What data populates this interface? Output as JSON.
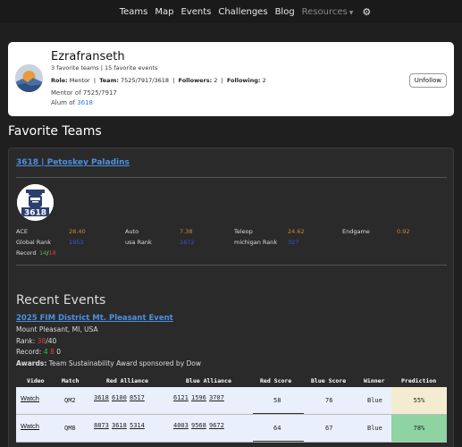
{
  "nav": {
    "items": [
      "Teams",
      "Map",
      "Events",
      "Challenges",
      "Blog"
    ],
    "resources_label": "Resources",
    "settings_icon": "gear-icon"
  },
  "profile": {
    "name": "Ezrafranseth",
    "subtitle": "3 favorite teams | 15 favorite events",
    "role_label": "Role:",
    "role": "Mentor",
    "team_label": "Team:",
    "team": "7525/7917/3618",
    "followers_label": "Followers:",
    "followers": "2",
    "following_label": "Following:",
    "following": "2",
    "mentor_text": "Mentor of 7525/7917",
    "alum_prefix": "Alum of ",
    "alum_team": "3618",
    "unfollow_label": "Unfollow"
  },
  "favorite_teams_title": "Favorite Teams",
  "team": {
    "link": "3618 | Petoskey Paladins",
    "logo_text": "3618",
    "stats": {
      "ace_label": "ACE",
      "ace": "28.40",
      "auto_label": "Auto",
      "auto": "7.38",
      "teleop_label": "Teleop",
      "teleop": "24.62",
      "endgame_label": "Endgame",
      "endgame": "0.92",
      "global_rank_label": "Global Rank",
      "global_rank": "1953",
      "usa_rank_label": "usa Rank",
      "usa_rank": "1672",
      "michigan_rank_label": "michigan Rank",
      "michigan_rank": "327",
      "record_label": "Record",
      "record_w": "14",
      "record_sep": "/",
      "record_l": "18"
    },
    "recent_events_title": "Recent Events",
    "event": {
      "name": "2025 FIM District Mt. Pleasant Event",
      "location": "Mount Pleasant, MI, USA",
      "rank_label": "Rank:",
      "rank": "38",
      "rank_total": "/40",
      "record_label": "Record:",
      "record_w": "4",
      "record_l": "8",
      "record_t": "0",
      "awards_label": "Awards:",
      "awards": "Team Sustainability Award sponsored by Dow"
    },
    "table": {
      "headers": [
        "Video",
        "Match",
        "Red Alliance",
        "Blue Alliance",
        "Red Score",
        "Blue Score",
        "Winner",
        "Prediction"
      ],
      "rows": [
        {
          "video": "Watch",
          "match": "QM2",
          "red": [
            "3618",
            "6100",
            "8517"
          ],
          "blue": [
            "6121",
            "1596",
            "3707"
          ],
          "red_score": "58",
          "blue_score": "76",
          "winner": "Blue",
          "prediction": "55%",
          "pred_color": "#f3ecd0"
        },
        {
          "video": "Watch",
          "match": "QM8",
          "red": [
            "8873",
            "3618",
            "5314"
          ],
          "blue": [
            "4003",
            "9568",
            "9672"
          ],
          "red_score": "64",
          "blue_score": "67",
          "winner": "Blue",
          "prediction": "78%",
          "pred_color": "#8fd3a2"
        }
      ]
    }
  },
  "colors": {
    "background": "#1f1f1f",
    "link": "#4d8fe0",
    "stat_orange": "#d08a2e",
    "stat_blue": "#3a55e0",
    "win_green": "#3cbf4f",
    "loss_red": "#e03c3c"
  }
}
